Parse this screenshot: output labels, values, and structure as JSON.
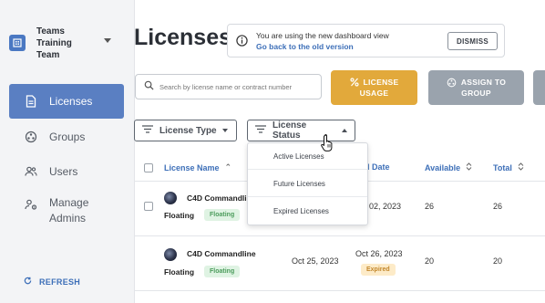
{
  "sidebar": {
    "team": {
      "name": "Teams Training Team"
    },
    "items": [
      {
        "label": "Licenses",
        "icon": "document-icon",
        "active": true
      },
      {
        "label": "Groups",
        "icon": "groups-icon"
      },
      {
        "label": "Users",
        "icon": "users-icon"
      },
      {
        "label": "Manage Admins",
        "icon": "manage-admins-icon"
      }
    ],
    "refresh_label": "REFRESH"
  },
  "header": {
    "title": "Licenses",
    "banner": {
      "message": "You are using the new dashboard view",
      "link": "Go back to the old version",
      "dismiss": "DISMISS"
    }
  },
  "toolbar": {
    "search_placeholder": "Search by license name or contract number",
    "license_usage_line1": "LICENSE",
    "license_usage_line2": "USAGE",
    "assign_line1": "ASSIGN TO",
    "assign_line2": "GROUP"
  },
  "filters": {
    "license_type": "License Type",
    "license_status": "License Status",
    "status_options": [
      "Active Licenses",
      "Future Licenses",
      "Expired Licenses"
    ]
  },
  "table": {
    "columns": {
      "license_name": "License Name",
      "end_date": "d Date",
      "available": "Available",
      "total": "Total"
    },
    "rows": [
      {
        "name": "C4D Commandline",
        "type": "Floating",
        "type_badge": "Floating",
        "start": "",
        "end": "y 02, 2023",
        "end_badge": "",
        "available": "26",
        "total": "26"
      },
      {
        "name": "C4D Commandline",
        "type": "Floating",
        "type_badge": "Floating",
        "start": "Oct 25, 2023",
        "end": "Oct 26, 2023",
        "end_badge": "Expired",
        "available": "20",
        "total": "20"
      }
    ]
  },
  "colors": {
    "accent_blue": "#5a7fc2",
    "license_usage": "#e2a93b",
    "assign_group": "#9aa3ad",
    "status_green": "#4c9c5c",
    "status_orange": "#c2862a"
  }
}
